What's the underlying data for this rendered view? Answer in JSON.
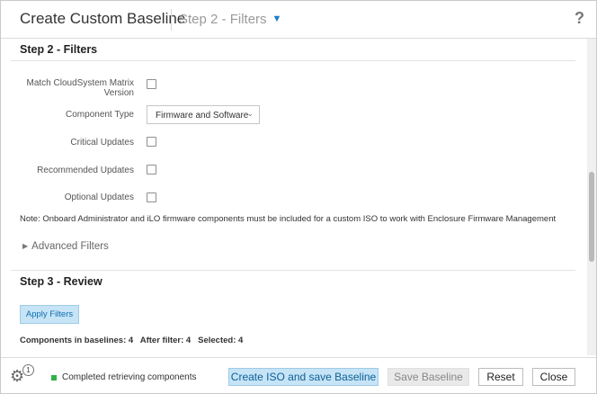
{
  "header": {
    "title": "Create Custom Baseline",
    "step_selector": "Step 2 - Filters",
    "help": "?"
  },
  "step2": {
    "title": "Step 2 - Filters",
    "fields": {
      "match_cloudsystem": {
        "label_line1": "Match CloudSystem Matrix",
        "label_line2": "Version",
        "checked": false
      },
      "component_type": {
        "label": "Component Type",
        "value": "Firmware and Software"
      },
      "critical_updates": {
        "label": "Critical Updates",
        "checked": false
      },
      "recommended_updates": {
        "label": "Recommended Updates",
        "checked": false
      },
      "optional_updates": {
        "label": "Optional Updates",
        "checked": false
      }
    },
    "note": "Note: Onboard Administrator and iLO firmware components must be included for a custom ISO to work with Enclosure Firmware Management",
    "advanced_filters": "Advanced Filters"
  },
  "step3": {
    "title": "Step 3 - Review",
    "apply_button": "Apply Filters",
    "counts": "Components in baselines: 4   After filter: 4   Selected: 4"
  },
  "footer": {
    "notification_count": "1",
    "status": "Completed retrieving components",
    "status_color": "#2db34a",
    "buttons": {
      "create_iso": "Create ISO and save Baseline",
      "save_baseline": "Save Baseline",
      "reset": "Reset",
      "close": "Close"
    }
  }
}
